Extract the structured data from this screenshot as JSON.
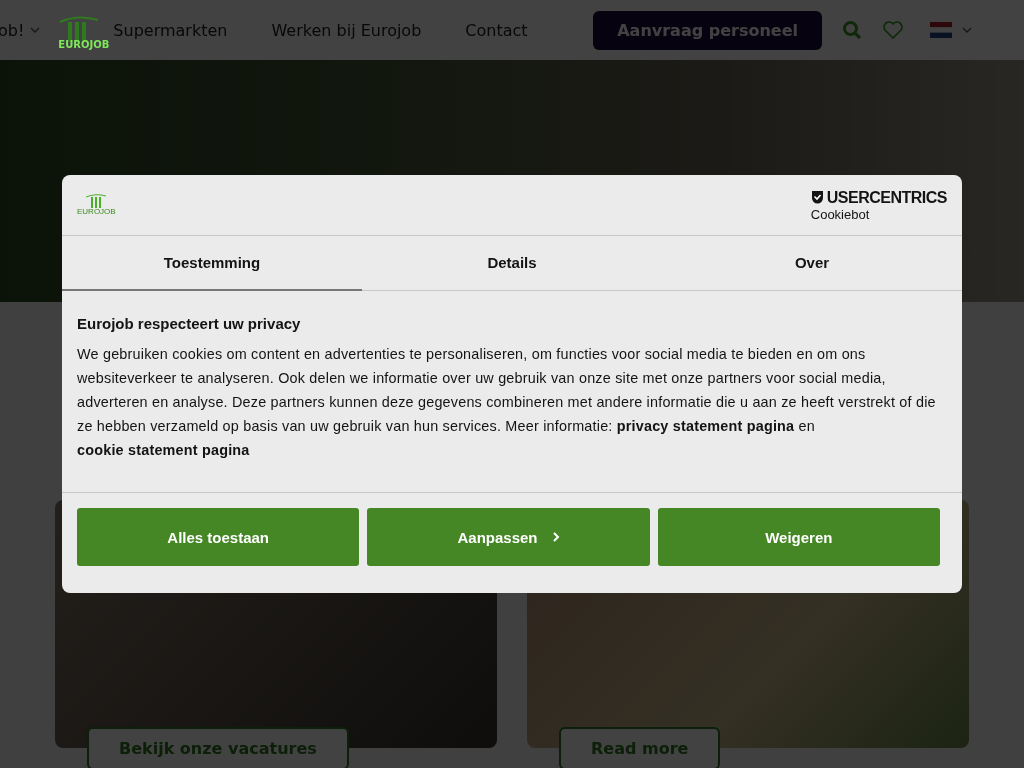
{
  "header": {
    "nav": [
      {
        "label": "ob!",
        "dropdown": true
      },
      {
        "label": "Supermarkten",
        "dropdown": false
      },
      {
        "label": "Werken bij Eurojob",
        "dropdown": false
      },
      {
        "label": "Contact",
        "dropdown": false
      }
    ],
    "logo_text": "EUROJOB",
    "cta": "Aanvraag personeel"
  },
  "cards": [
    {
      "button": "Bekijk onze vacatures"
    },
    {
      "button": "Read more"
    }
  ],
  "cookie_dialog": {
    "logo_text": "EUROJOB",
    "brand": "USERCENTRICS",
    "brand_sub": "Cookiebot",
    "tabs": [
      {
        "label": "Toestemming",
        "selected": true
      },
      {
        "label": "Details",
        "selected": false
      },
      {
        "label": "Over",
        "selected": false
      }
    ],
    "heading": "Eurojob respecteert uw privacy",
    "body": "We gebruiken cookies om content en advertenties te personaliseren, om functies voor social media te bieden en om ons websiteverkeer te analyseren. Ook delen we informatie over uw gebruik van onze site met onze partners voor social media, adverteren en analyse. Deze partners kunnen deze gegevens combineren met andere informatie die u aan ze heeft verstrekt of die ze hebben verzameld op basis van uw gebruik van hun services. Meer informatie:",
    "links": [
      "privacy statement pagina",
      "cookie statement pagina"
    ],
    "link_joiner": "en",
    "buttons": [
      {
        "label": "Alles toestaan",
        "chevron": false
      },
      {
        "label": "Aanpassen",
        "chevron": true
      },
      {
        "label": "Weigeren",
        "chevron": false
      }
    ]
  }
}
